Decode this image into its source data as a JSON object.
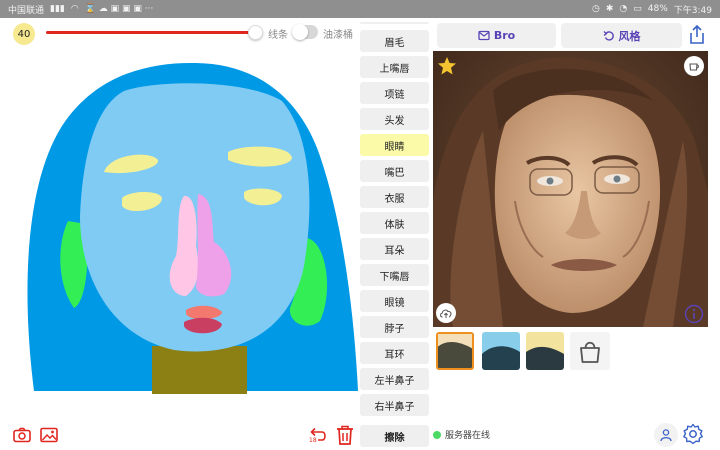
{
  "status_bar": {
    "carrier": "中国联通",
    "battery": "48%",
    "time": "下午3:49"
  },
  "toolbar": {
    "brush_size": "40",
    "line_label": "线条",
    "fill_label": "油漆桶",
    "brush_color": "#e0261f"
  },
  "parts": {
    "items": [
      {
        "label": "眉毛"
      },
      {
        "label": "上嘴唇"
      },
      {
        "label": "项链"
      },
      {
        "label": "头发"
      },
      {
        "label": "眼睛"
      },
      {
        "label": "嘴巴"
      },
      {
        "label": "衣服"
      },
      {
        "label": "体肤"
      },
      {
        "label": "耳朵"
      },
      {
        "label": "下嘴唇"
      },
      {
        "label": "眼镜"
      },
      {
        "label": "脖子"
      },
      {
        "label": "耳环"
      },
      {
        "label": "左半鼻子"
      },
      {
        "label": "右半鼻子"
      }
    ],
    "active_label": "眼睛",
    "erase_label": "擦除"
  },
  "tabs": {
    "bro_label": "Bro",
    "style_label": "风格"
  },
  "status": {
    "server_text": "服务器在线",
    "undo_count": "18"
  },
  "colors": {
    "accent": "#5a43b7",
    "active_part": "#fafaa8",
    "server_online": "#4cd964",
    "delete": "#e0261f"
  }
}
